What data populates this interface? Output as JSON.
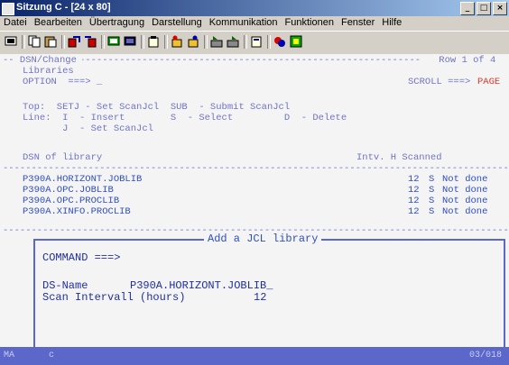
{
  "window": {
    "title": "Sitzung C - [24 x 80]",
    "minimize": "_",
    "maximize": "□",
    "close": "×"
  },
  "menu": [
    "Datei",
    "Bearbeiten",
    "Übertragung",
    "Darstellung",
    "Kommunikation",
    "Funktionen",
    "Fenster",
    "Hilfe"
  ],
  "toolbar": {
    "icons": [
      "screen-icon",
      "copy-icon",
      "paste-icon",
      "send-file-icon",
      "receive-file-icon",
      "display-icon",
      "macro-icon",
      "clipboard-icon",
      "start-record-icon",
      "stop-record-icon",
      "play-macro-icon",
      "record-icon",
      "properties-icon",
      "help-icon",
      "color-icon",
      "green-square-icon"
    ]
  },
  "colors": {
    "screen_bg": "#f4f4f4",
    "field_blue": "#6f73c6",
    "intense_blue": "#2f4fbf",
    "red": "#d43a2a",
    "popup_border": "#5b67c9",
    "statusbar": "#5b67c9"
  },
  "screen": {
    "header_left": "-- DSN/Change ",
    "header_right": " Row 1 of 4",
    "subtitle": "Libraries",
    "option_label": "OPTION  ===> _",
    "scroll_label": "SCROLL ===> ",
    "scroll_value": "PAGE",
    "help1": "Top:  SETJ - Set ScanJcl  SUB  - Submit ScanJcl",
    "help2": "Line:  I  - Insert        S  - Select         D  - Delete",
    "help3": "       J  - Set ScanJcl",
    "col_dsn": "DSN of library",
    "col_intv": "Intv. H Scanned",
    "rows": [
      {
        "dsn": "P390A.HORIZONT.JOBLIB",
        "intv": "12",
        "h": "S",
        "scanned": "Not done"
      },
      {
        "dsn": "P390A.OPC.JOBLIB",
        "intv": "12",
        "h": "S",
        "scanned": "Not done"
      },
      {
        "dsn": "P390A.OPC.PROCLIB",
        "intv": "12",
        "h": "S",
        "scanned": "Not done"
      },
      {
        "dsn": "P390A.XINFO.PROCLIB",
        "intv": "12",
        "h": "S",
        "scanned": "Not done"
      }
    ]
  },
  "popup": {
    "title": "Add a JCL library",
    "command": "COMMAND ===>",
    "ds_label": "DS-Name",
    "ds_value": "P390A.HORIZONT.JOBLIB_",
    "scan_label": "Scan Intervall (hours)",
    "scan_value": "12"
  },
  "status": {
    "left": "MA",
    "mode": "c",
    "position": "03/018"
  }
}
